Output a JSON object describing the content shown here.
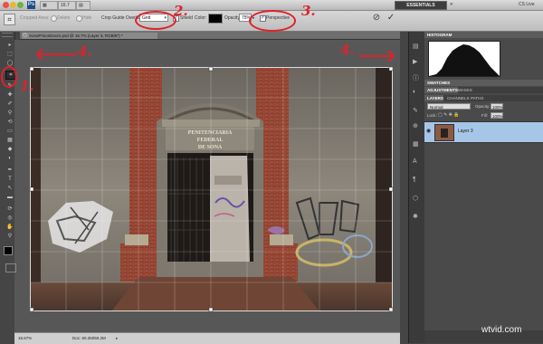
{
  "titlebar": {
    "app_logo": "Ps",
    "menu_zoom": "16.7",
    "menu_arrange": "▤",
    "workspace": "ESSENTIALS",
    "cs_live": "CS Live"
  },
  "options": {
    "cropped_area": "Cropped Area:",
    "delete": "Delete",
    "hide": "Hide",
    "crop_guide_overlay_label": "Crop Guide Overlay:",
    "crop_guide_overlay_value": "Grid",
    "shield_label": "Shield",
    "color_label": "Color:",
    "opacity_label": "Opacity:",
    "opacity_value": "75%",
    "perspective_label": "Perspective",
    "annotation_2": "2.",
    "annotation_3": "3."
  },
  "document": {
    "tab_title": "SonaPrisonDoors.psd @ 16.7% (Layer 3, RGB/8*) *",
    "zoom": "16.67%",
    "doc_size": "Doc: 60.2M/60.2M"
  },
  "annotations": {
    "arrow_left": "4.",
    "arrow_right": "4.",
    "crop_tool": "1."
  },
  "photo": {
    "sign_line1": "PENITENCIARIA",
    "sign_line2": "FEDERAL",
    "sign_line3": "DE SONA"
  },
  "tools": [
    "▸",
    "⬚",
    "◯",
    "⌖",
    "✎",
    "⬛",
    "✧",
    "⟲",
    "✐",
    "◐",
    "⬤",
    "✒",
    "T",
    "↖",
    "▭",
    "✋",
    "🔍"
  ],
  "panels": {
    "histogram_tab": "HISTOGRAM",
    "swatches_tab": "SWATCHES",
    "adjustments_tab": "ADJUSTMENTS",
    "masks_tab": "MASKS",
    "layers_tab": "LAYERS",
    "channels_tab": "CHANNELS",
    "paths_tab": "PATHS",
    "blend_mode": "Normal",
    "opacity_label": "Opacity:",
    "opacity_value": "100%",
    "lock_label": "Lock:",
    "fill_label": "Fill:",
    "fill_value": "100%",
    "layer_name": "Layer 3"
  },
  "watermark": "wtvid.com",
  "colors": {
    "annotation_red": "#e0212b",
    "brick": "#8e3b2a",
    "wall": "#8c8579"
  }
}
